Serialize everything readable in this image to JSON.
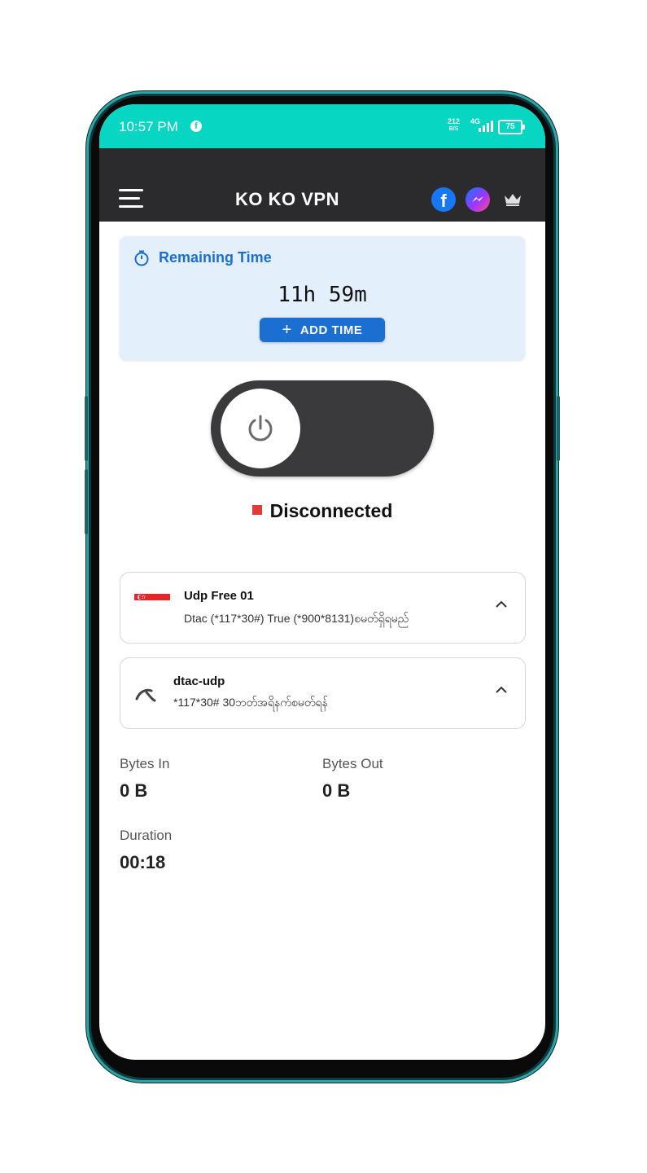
{
  "status_bar": {
    "time": "10:57 PM",
    "net_speed_value": "212",
    "net_speed_unit": "B/S",
    "network_type": "4G",
    "battery": "75"
  },
  "app_bar": {
    "title": "KO KO VPN",
    "icons": [
      "menu-icon",
      "facebook-icon",
      "messenger-icon",
      "crown-icon"
    ]
  },
  "remaining_time": {
    "label": "Remaining Time",
    "value": "11h 59m",
    "add_button": "ADD TIME"
  },
  "connection": {
    "state": "Disconnected",
    "status_color": "#e53935"
  },
  "server": {
    "name": "Udp Free 01",
    "description": "Dtac (*117*30#) True (*900*8131)စမတ်ရှိရမည်"
  },
  "network": {
    "name": "dtac-udp",
    "description": "*117*30# 30ဘတ်အရိနက်စမတ်ရန်"
  },
  "stats": {
    "bytes_in_label": "Bytes In",
    "bytes_in_value": "0 B",
    "bytes_out_label": "Bytes Out",
    "bytes_out_value": "0 B",
    "duration_label": "Duration",
    "duration_value": "00:18"
  },
  "colors": {
    "status_bar": "#07d6c3",
    "app_bar": "#2b2b2d",
    "accent": "#1b6fd0",
    "card_bg": "#e3effb"
  }
}
